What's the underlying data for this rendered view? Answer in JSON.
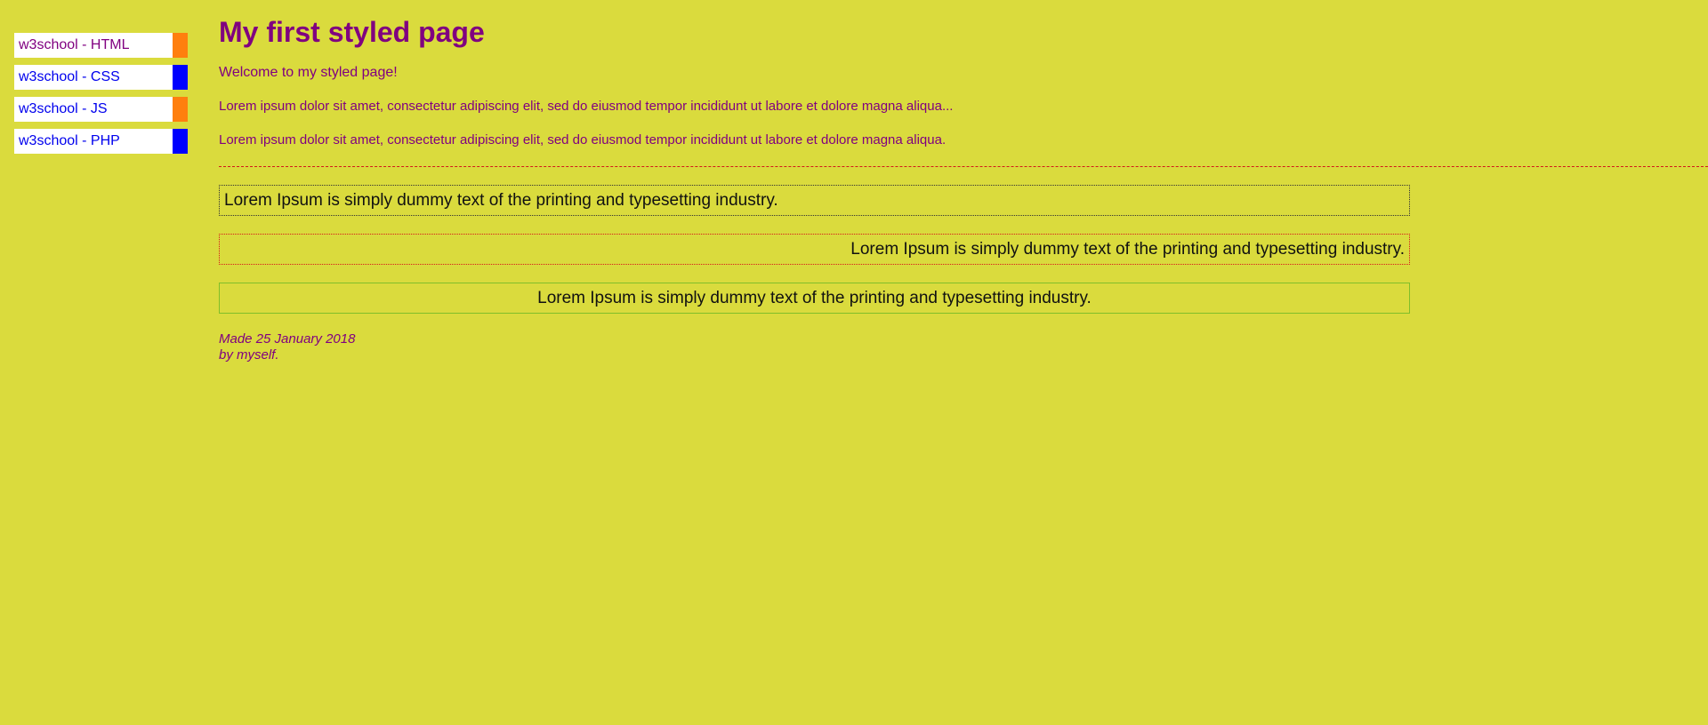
{
  "page": {
    "background_color": "#dadb3d",
    "text_color": "#800080"
  },
  "nav": {
    "items": [
      {
        "label": "w3school - HTML",
        "accent": "#ff7f0e",
        "link_state": "visited"
      },
      {
        "label": "w3school - CSS",
        "accent": "#0000ff",
        "link_state": "unvisited"
      },
      {
        "label": "w3school - JS",
        "accent": "#ff7f0e",
        "link_state": "unvisited"
      },
      {
        "label": "w3school - PHP",
        "accent": "#0000ff",
        "link_state": "unvisited"
      }
    ]
  },
  "main": {
    "title": "My first styled page",
    "intro": "Welcome to my styled page!",
    "paragraphs": [
      "Lorem ipsum dolor sit amet, consectetur adipiscing elit, sed do eiusmod tempor incididunt ut labore et dolore magna aliqua...",
      "Lorem ipsum dolor sit amet, consectetur adipiscing elit, sed do eiusmod tempor incididunt ut labore et dolore magna aliqua."
    ],
    "boxes": [
      {
        "text": "Lorem Ipsum is simply dummy text of the printing and typesetting industry.",
        "align": "left",
        "border_color": "#333333"
      },
      {
        "text": "Lorem Ipsum is simply dummy text of the printing and typesetting industry.",
        "align": "right",
        "border_color": "#d61a1a"
      },
      {
        "text": "Lorem Ipsum is simply dummy text of the printing and typesetting industry.",
        "align": "center",
        "border_color": "#7fbf2a"
      }
    ],
    "footer": {
      "line1": "Made 25 January 2018",
      "line2": "by myself."
    }
  }
}
